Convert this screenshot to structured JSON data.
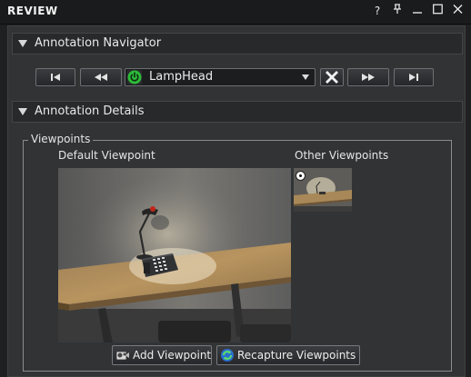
{
  "window": {
    "title": "REVIEW",
    "help": "?",
    "pin": "⊥",
    "minimize": "—",
    "maximize": "□",
    "close": "✕"
  },
  "navigator": {
    "header": "Annotation Navigator",
    "selected_annotation": "LampHead"
  },
  "details": {
    "header": "Annotation Details",
    "viewpoints_group": "Viewpoints",
    "default_label": "Default Viewpoint",
    "other_label": "Other Viewpoints",
    "add_button": "Add Viewpoint",
    "recapture_button": "Recapture Viewpoints"
  },
  "colors": {
    "accent_green": "#2dbb3a",
    "panel_bg": "#313335"
  }
}
